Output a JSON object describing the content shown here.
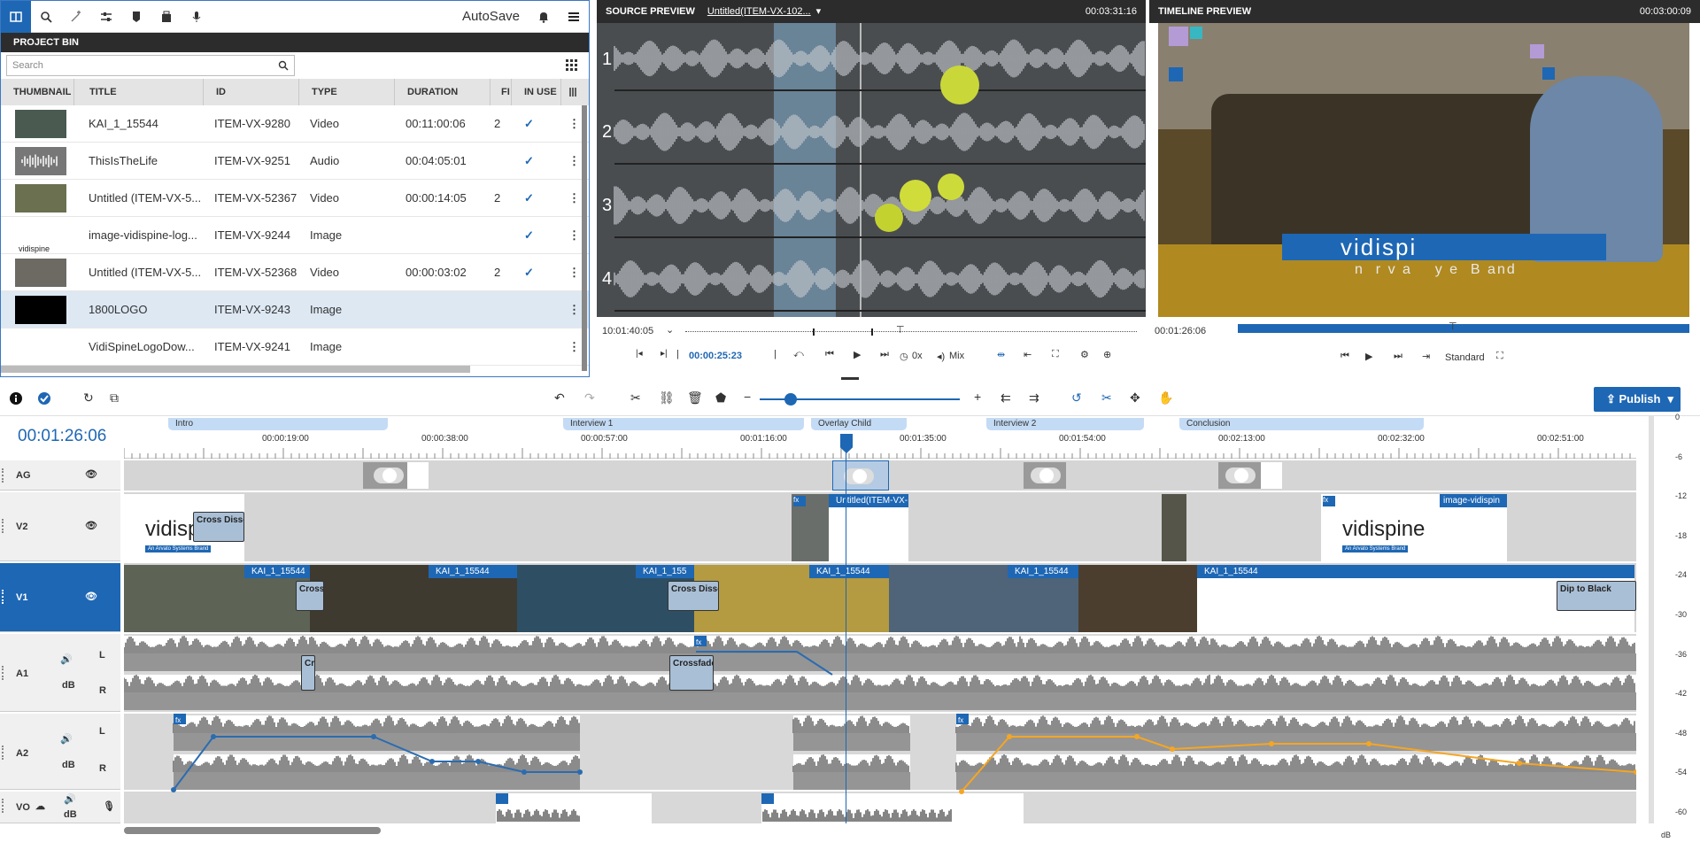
{
  "toolbar_top": {
    "autosave": "AutoSave"
  },
  "bin": {
    "title": "PROJECT BIN",
    "search_placeholder": "Search",
    "columns": [
      "THUMBNAIL",
      "TITLE",
      "ID",
      "TYPE",
      "DURATION",
      "FI",
      "IN USE"
    ],
    "rows": [
      {
        "title": "KAI_1_15544",
        "id": "ITEM-VX-9280",
        "type": "Video",
        "duration": "00:11:00:06",
        "fi": "2",
        "in_use": "✓",
        "thumb": "#4a5a50"
      },
      {
        "title": "ThisIsTheLife",
        "id": "ITEM-VX-9251",
        "type": "Audio",
        "duration": "00:04:05:01",
        "fi": "",
        "in_use": "✓",
        "thumb": "#777"
      },
      {
        "title": "Untitled (ITEM-VX-5...",
        "id": "ITEM-VX-52367",
        "type": "Video",
        "duration": "00:00:14:05",
        "fi": "2",
        "in_use": "✓",
        "thumb": "#6a7050"
      },
      {
        "title": "image-vidispine-log...",
        "id": "ITEM-VX-9244",
        "type": "Image",
        "duration": "",
        "fi": "",
        "in_use": "✓",
        "thumb": "#fff"
      },
      {
        "title": "Untitled (ITEM-VX-5...",
        "id": "ITEM-VX-52368",
        "type": "Video",
        "duration": "00:00:03:02",
        "fi": "2",
        "in_use": "✓",
        "thumb": "#6d6a64"
      },
      {
        "title": "1800LOGO",
        "id": "ITEM-VX-9243",
        "type": "Image",
        "duration": "",
        "fi": "",
        "in_use": "",
        "thumb": "#000"
      },
      {
        "title": "VidiSpineLogoDow...",
        "id": "ITEM-VX-9241",
        "type": "Image",
        "duration": "",
        "fi": "",
        "in_use": "",
        "thumb": "#fff"
      }
    ]
  },
  "source": {
    "title": "SOURCE PREVIEW",
    "clip": "Untitled(ITEM-VX-102...",
    "timecode": "00:03:31:16",
    "channels": [
      "1",
      "2",
      "3",
      "4"
    ],
    "pos": "10:01:40:05",
    "current": "00:00:25:23",
    "speed": "0x",
    "mix": "Mix"
  },
  "timeline_preview": {
    "title": "TIMELINE PREVIEW",
    "timecode": "00:03:00:09",
    "pos": "00:01:26:06",
    "quality": "Standard",
    "overlay_text": "vidispi",
    "overlay_sub": "n  r v a    y e  B and"
  },
  "timeline": {
    "timecode": "00:01:26:06",
    "publish": "Publish",
    "markers": [
      "Intro",
      "Interview 1",
      "Overlay Child",
      "Interview 2",
      "Conclusion"
    ],
    "ticks": [
      "00:00:19:00",
      "00:00:38:00",
      "00:00:57:00",
      "00:01:16:00",
      "00:01:35:00",
      "00:01:54:00",
      "00:02:13:00",
      "00:02:32:00",
      "00:02:51:00"
    ],
    "tracks": [
      "AG",
      "V2",
      "V1",
      "A1",
      "A2",
      "VO"
    ],
    "lr": [
      "L",
      "R"
    ],
    "db": "dB",
    "v2_clips": [
      "Untitled(ITEM-VX-",
      "image-vidispin"
    ],
    "v1_clips": [
      "KAI_1_15544",
      "KAI_1_15544",
      "KAI_1_155",
      "KAI_1_15544",
      "KAI_1_15544",
      "KAI_1_15544"
    ],
    "transitions": [
      "Cross Dissolv",
      "Cross",
      "Cross Disso",
      "Dip to Black",
      "Cr",
      "Crossfade"
    ],
    "logo_text": "vidispine",
    "logo_sub": "An Arvato Systems Brand",
    "db_scale": [
      "0",
      "-6",
      "-12",
      "-18",
      "-24",
      "-30",
      "-36",
      "-42",
      "-48",
      "-54",
      "-60",
      "dB"
    ]
  },
  "colors": {
    "accent": "#1e67b4",
    "keyframe_blue": "#2b6cb0",
    "keyframe_orange": "#f5a623"
  }
}
